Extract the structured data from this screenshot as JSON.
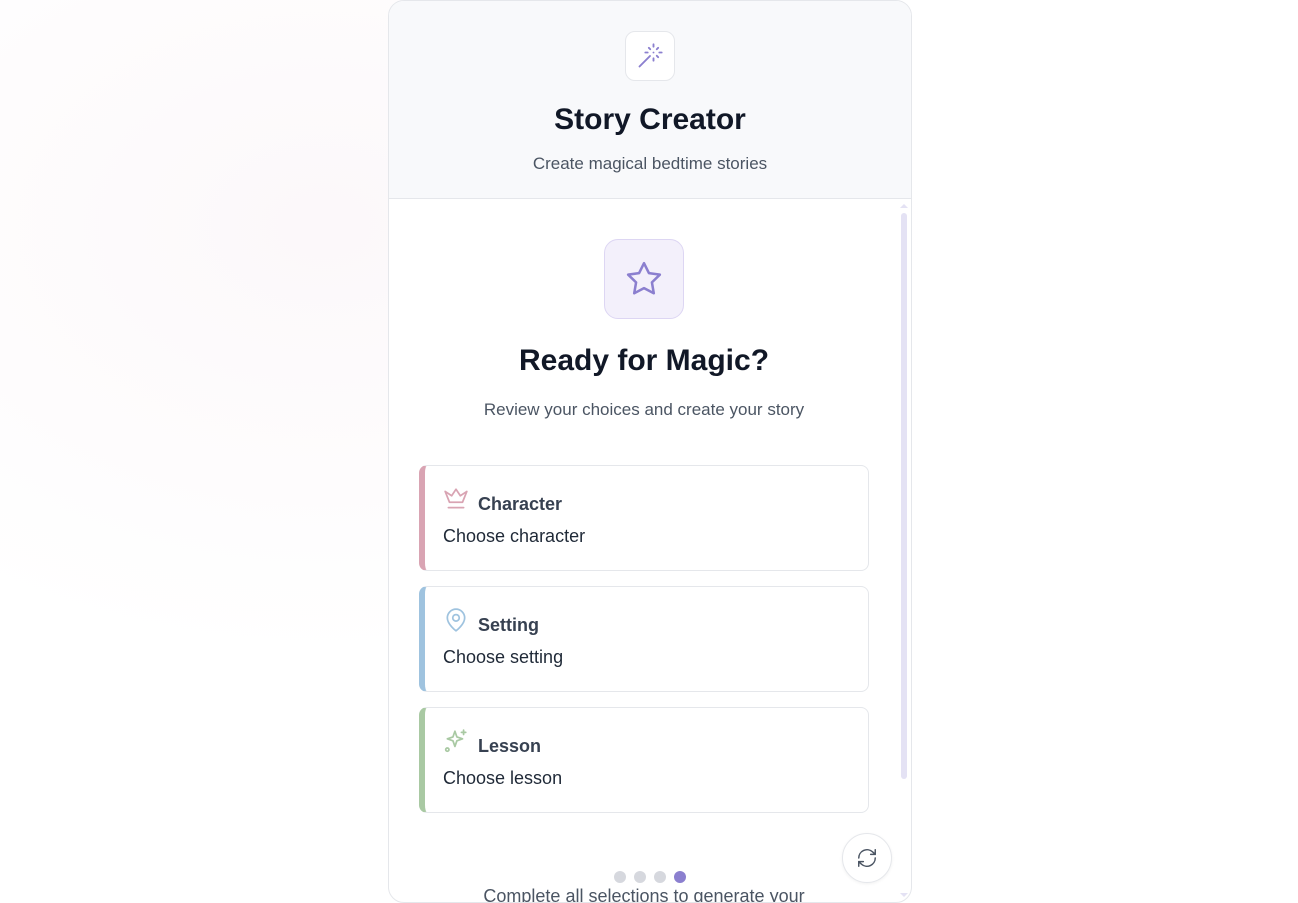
{
  "header": {
    "title": "Story Creator",
    "subtitle": "Create magical bedtime stories",
    "logo_icon": "magic-wand-icon"
  },
  "main": {
    "hero_icon": "star-icon",
    "title": "Ready for Magic?",
    "subtitle": "Review your choices and create your story",
    "cards": [
      {
        "title": "Character",
        "value": "Choose character",
        "icon": "crown-icon",
        "accent": "#d9a4b3"
      },
      {
        "title": "Setting",
        "value": "Choose setting",
        "icon": "map-pin-icon",
        "accent": "#9fc3df"
      },
      {
        "title": "Lesson",
        "value": "Choose lesson",
        "icon": "sparkles-icon",
        "accent": "#a9c9a3"
      }
    ],
    "footer_note": "Complete all selections to generate your",
    "refresh_icon": "refresh-icon"
  },
  "progress": {
    "total_steps": 4,
    "current_step": 4
  },
  "colors": {
    "primary": "#8b7fcf",
    "title": "#111827",
    "muted": "#4b5563"
  }
}
